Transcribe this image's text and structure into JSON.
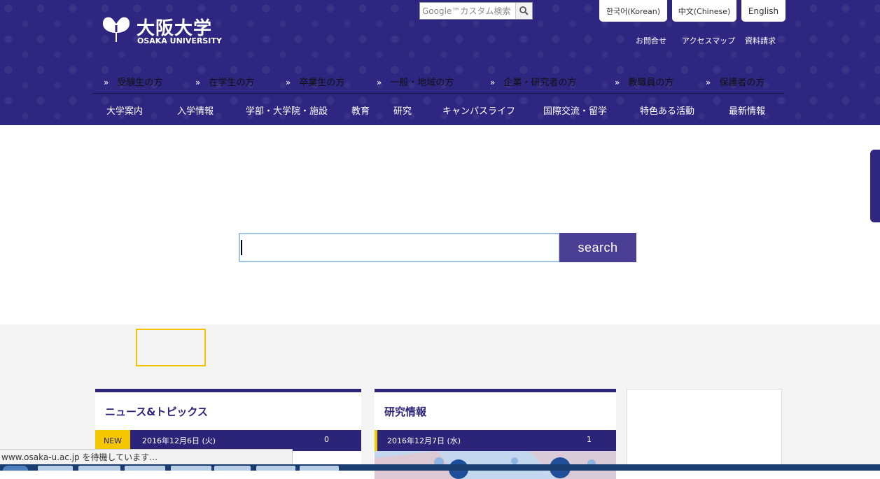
{
  "header": {
    "logo_jp": "大阪大学",
    "logo_en": "OSAKA UNIVERSITY",
    "google_placeholder": "Google™カスタム検索",
    "languages": [
      "한국어(Korean)",
      "中文(Chinese)",
      "English"
    ],
    "utility_links": [
      "お問合せ",
      "アクセスマップ",
      "資料請求"
    ],
    "audience_nav": [
      "受験生の方",
      "在学生の方",
      "卒業生の方",
      "一般・地域の方",
      "企業・研究者の方",
      "教職員の方",
      "保護者の方"
    ],
    "global_nav": [
      "大学案内",
      "入学情報",
      "学部・大学院・施設",
      "教育",
      "研究",
      "キャンパスライフ",
      "国際交流・留学",
      "特色ある活動",
      "最新情報"
    ]
  },
  "search": {
    "value": "",
    "button_label": "search"
  },
  "cards": {
    "news": {
      "title": "ニュース&トピックス",
      "badge": "NEW",
      "date": "2016年12月6日 (火)",
      "count": "0"
    },
    "research": {
      "title": "研究情報",
      "date": "2016年12月7日 (水)",
      "count": "1"
    }
  },
  "status": {
    "text": "www.osaka-u.ac.jp を待機しています…"
  },
  "colors": {
    "brand": "#2e2680",
    "accent": "#f6c600",
    "search_button": "#4a3f95"
  }
}
